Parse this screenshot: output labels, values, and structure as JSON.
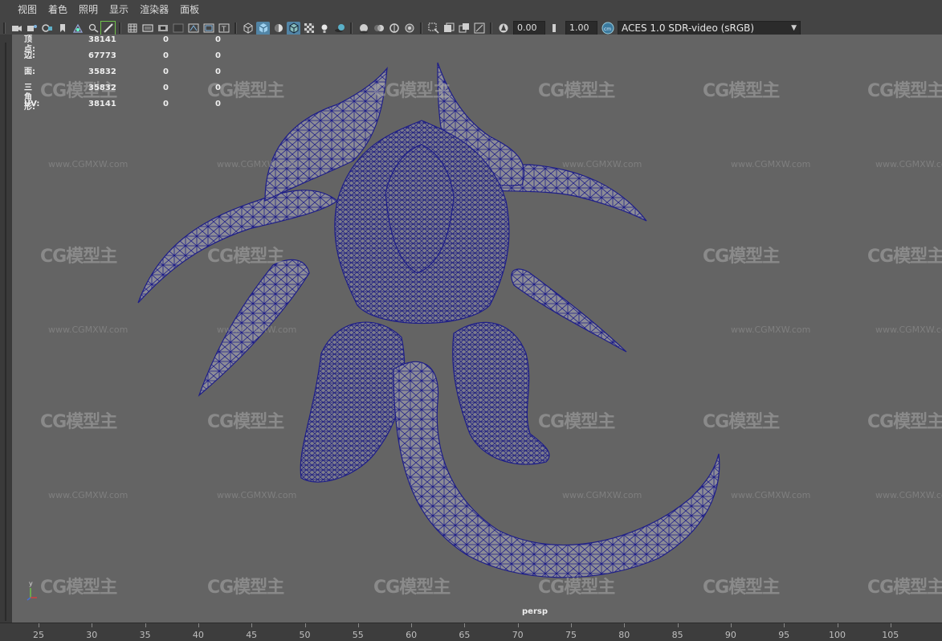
{
  "menu": {
    "items": [
      "视图",
      "着色",
      "照明",
      "显示",
      "渲染器",
      "面板"
    ]
  },
  "toolbar": {
    "exposure_value": "0.00",
    "gamma_value": "1.00",
    "color_management_view": "ACES 1.0 SDR-video (sRGB)"
  },
  "hud": {
    "rows": [
      {
        "label": "顶点:",
        "values": [
          "38141",
          "0",
          "0"
        ]
      },
      {
        "label": "边:",
        "values": [
          "67773",
          "0",
          "0"
        ]
      },
      {
        "label": "面:",
        "values": [
          "35832",
          "0",
          "0"
        ]
      },
      {
        "label": "三角形:",
        "values": [
          "35832",
          "0",
          "0"
        ]
      },
      {
        "label": "UV:",
        "values": [
          "38141",
          "0",
          "0"
        ]
      }
    ]
  },
  "viewport": {
    "camera_label": "persp",
    "axis_x": "x",
    "axis_y": "y",
    "watermark_logo": "CG模型主",
    "watermark_url": "www.CGMXW.com"
  },
  "timeline": {
    "ticks": [
      "25",
      "30",
      "35",
      "40",
      "45",
      "50",
      "55",
      "60",
      "65",
      "70",
      "75",
      "80",
      "85",
      "90",
      "95",
      "100",
      "105"
    ]
  },
  "colors": {
    "viewport_bg": "#646464",
    "wireframe": "#1e1e88",
    "mesh_fill": "#8e8e98",
    "active_button": "#5285a6"
  }
}
